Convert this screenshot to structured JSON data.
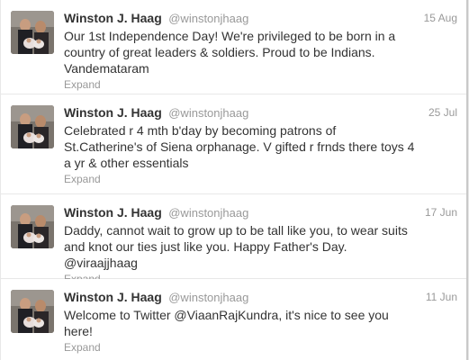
{
  "tweets": [
    {
      "fullname": "Winston J. Haag",
      "username": "@winstonjhaag",
      "time": "15 Aug",
      "text": "Our 1st Independence Day! We're privileged to be born in a country of great leaders & soldiers. Proud to be Indians. Vandemataram",
      "expand": "Expand"
    },
    {
      "fullname": "Winston J. Haag",
      "username": "@winstonjhaag",
      "time": "25 Jul",
      "text": "Celebrated r 4 mth b'day by becoming patrons of St.Catherine's of Siena orphanage. V gifted r frnds there toys 4 a yr & other essentials",
      "expand": "Expand"
    },
    {
      "fullname": "Winston J. Haag",
      "username": "@winstonjhaag",
      "time": "17 Jun",
      "text": "Daddy, cannot wait to grow up to be tall like you, to wear suits and knot our ties just like you. Happy Father's Day. @viraajjhaag",
      "expand": "Expand"
    },
    {
      "fullname": "Winston J. Haag",
      "username": "@winstonjhaag",
      "time": "11 Jun",
      "text": "Welcome to Twitter @ViaanRajKundra, it's nice to see you here!",
      "expand": "Expand"
    }
  ],
  "icons": {
    "avatar": "profile-photo"
  },
  "colors": {
    "text": "#333333",
    "muted": "#999999",
    "divider": "#e8e8e8"
  }
}
